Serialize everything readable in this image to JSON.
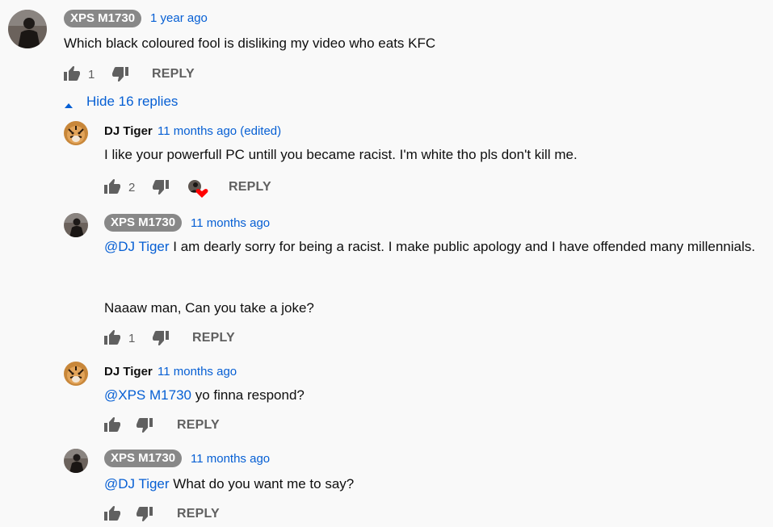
{
  "comments": [
    {
      "author": "XPS M1730",
      "time": "1 year ago",
      "text": "Which black coloured fool is disliking my video who eats KFC",
      "likes": "1",
      "reply_label": "REPLY"
    }
  ],
  "hide_replies_label": "Hide 16 replies",
  "replies": [
    {
      "author": "DJ Tiger",
      "time": "11 months ago (edited)",
      "text": "I like your powerfull PC untill you became racist. I'm white tho pls don't kill me.",
      "likes": "2",
      "reply_label": "REPLY"
    },
    {
      "author": "XPS M1730",
      "time": "11 months ago",
      "mention": "@DJ Tiger",
      "text": " I am dearly sorry for being a racist. I make public apology and I have offended many millennials.",
      "text2": "Naaaw man, Can you take a joke?",
      "likes": "1",
      "reply_label": "REPLY"
    },
    {
      "author": "DJ Tiger",
      "time": "11 months ago",
      "mention": "@XPS M1730",
      "text": " yo finna respond?",
      "reply_label": "REPLY"
    },
    {
      "author": "XPS M1730",
      "time": "11 months ago",
      "mention": "@DJ Tiger",
      "text": " What do you want me to say?",
      "reply_label": "REPLY"
    }
  ],
  "icons": {
    "like": "thumbs-up-icon",
    "dislike": "thumbs-down-icon",
    "creator_heart": "creator-heart-icon",
    "caret_up": "caret-up-icon"
  },
  "colors": {
    "link": "#065fd4",
    "badge": "#888888",
    "muted": "#606060",
    "heart": "#ff0000"
  }
}
